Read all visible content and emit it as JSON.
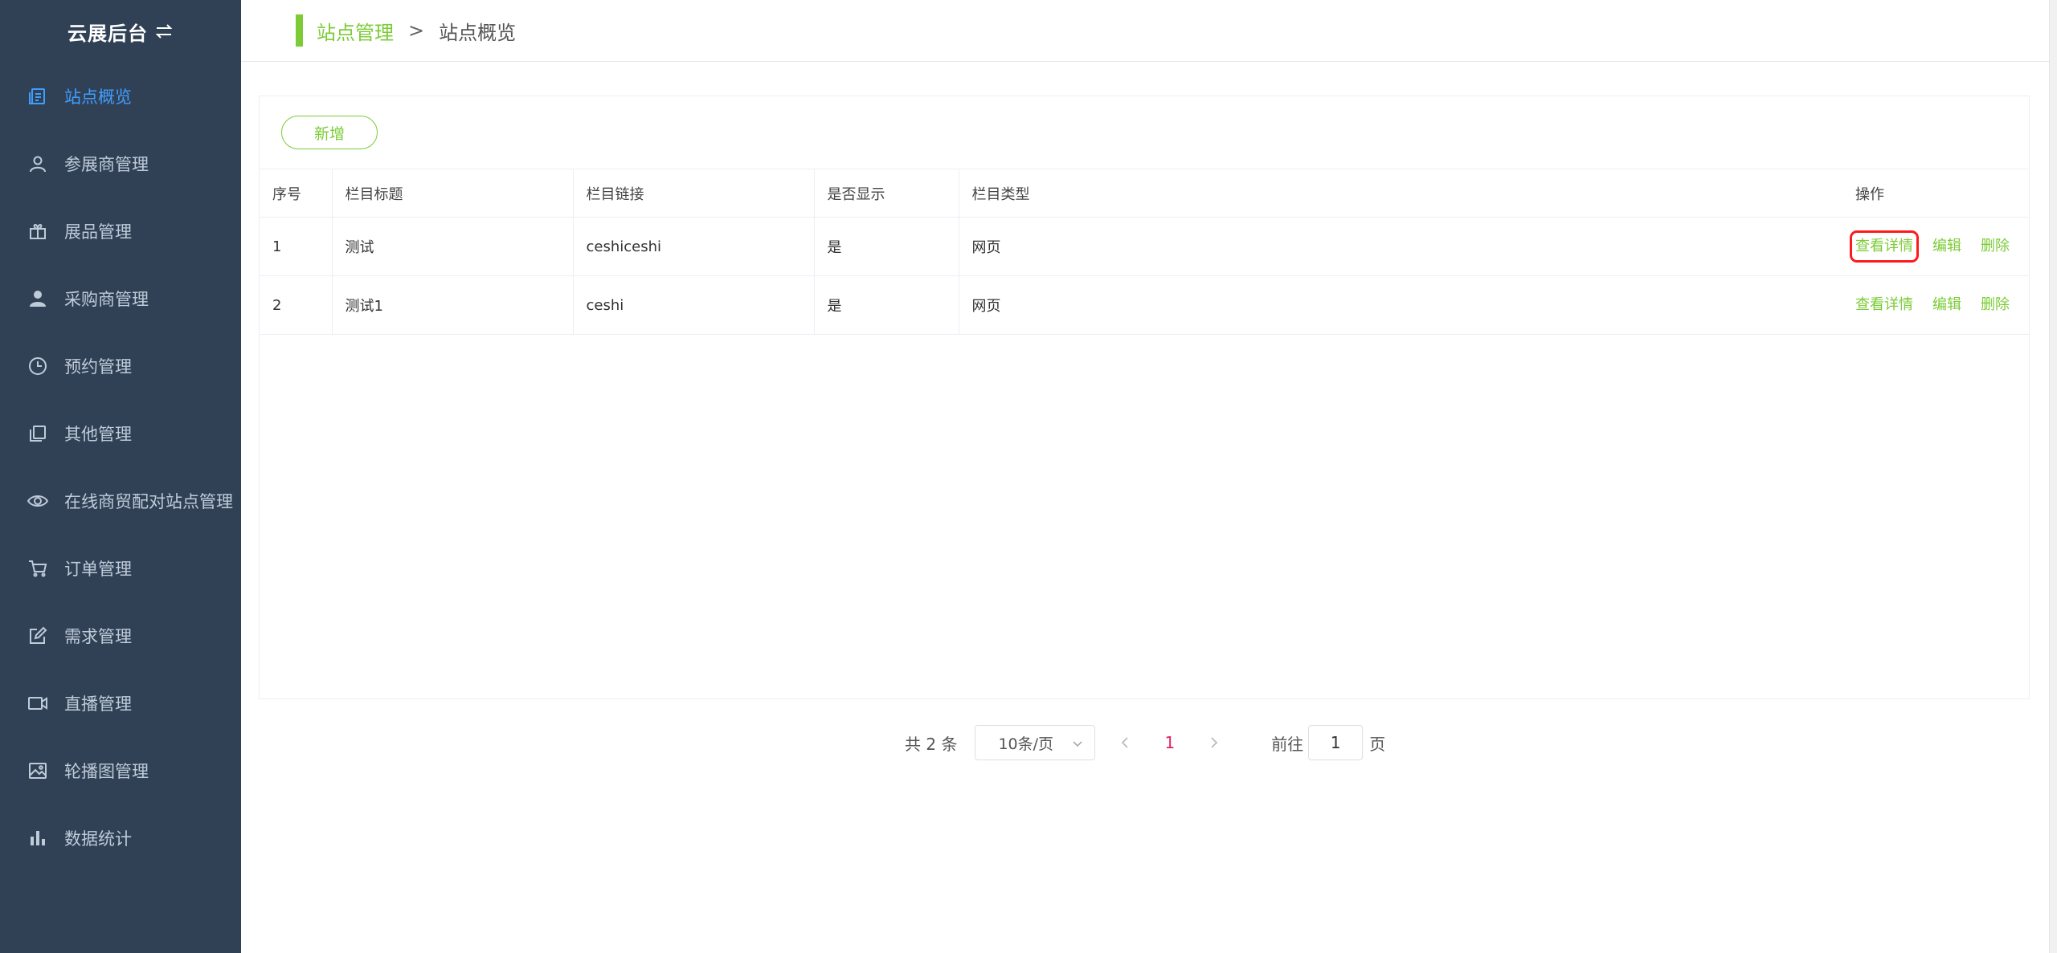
{
  "brand": {
    "title": "云展后台",
    "switch_icon": "swap-icon"
  },
  "sidebar": {
    "items": [
      {
        "label": "站点概览",
        "icon": "document-icon",
        "active": true
      },
      {
        "label": "参展商管理",
        "icon": "user-icon",
        "active": false
      },
      {
        "label": "展品管理",
        "icon": "gift-icon",
        "active": false
      },
      {
        "label": "采购商管理",
        "icon": "person-fill-icon",
        "active": false
      },
      {
        "label": "预约管理",
        "icon": "clock-icon",
        "active": false
      },
      {
        "label": "其他管理",
        "icon": "copy-icon",
        "active": false
      },
      {
        "label": "在线商贸配对站点管理",
        "icon": "eye-icon",
        "active": false
      },
      {
        "label": "订单管理",
        "icon": "cart-icon",
        "active": false
      },
      {
        "label": "需求管理",
        "icon": "edit-icon",
        "active": false
      },
      {
        "label": "直播管理",
        "icon": "video-camera-icon",
        "active": false
      },
      {
        "label": "轮播图管理",
        "icon": "picture-icon",
        "active": false
      },
      {
        "label": "数据统计",
        "icon": "bar-chart-icon",
        "active": false
      }
    ]
  },
  "breadcrumb": {
    "parent": "站点管理",
    "separator": ">",
    "current": "站点概览"
  },
  "toolbar": {
    "add_label": "新增"
  },
  "table": {
    "headers": [
      "序号",
      "栏目标题",
      "栏目链接",
      "是否显示",
      "栏目类型",
      "操作"
    ],
    "rows": [
      {
        "index": "1",
        "title": "测试",
        "link": "ceshiceshi",
        "visible": "是",
        "type": "网页"
      },
      {
        "index": "2",
        "title": "测试1",
        "link": "ceshi",
        "visible": "是",
        "type": "网页"
      }
    ],
    "actions": {
      "view": "查看详情",
      "edit": "编辑",
      "delete": "删除"
    }
  },
  "pagination": {
    "total_text": "共 2 条",
    "page_size": "10条/页",
    "current_page": "1",
    "goto_label": "前往",
    "goto_value": "1",
    "page_suffix": "页"
  },
  "colors": {
    "sidebar_bg": "#304156",
    "sidebar_text": "#bfcbd9",
    "sidebar_active": "#409eff",
    "accent": "#7ccb37",
    "highlight": "#ff1a1a",
    "page_current": "#e0245e"
  }
}
